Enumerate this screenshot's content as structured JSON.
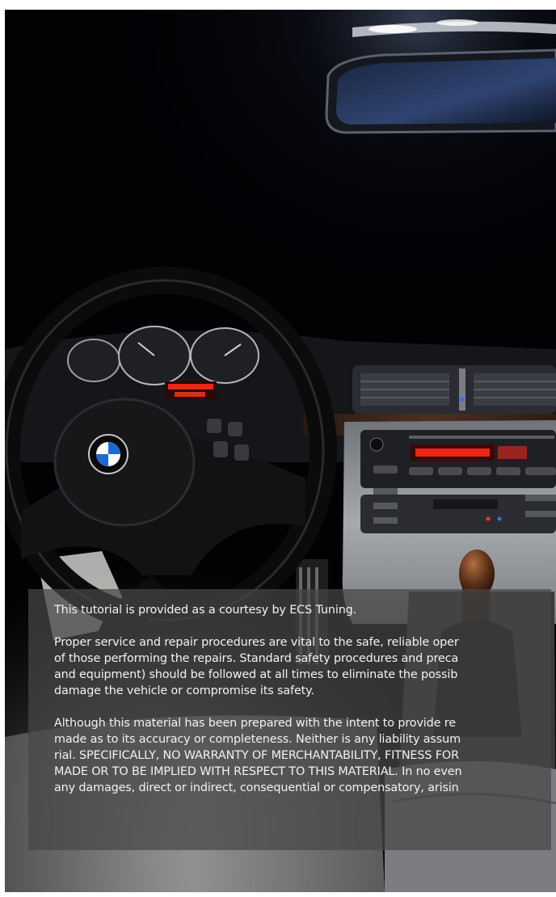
{
  "document": {
    "photo_subject": "BMW dashboard interior at night",
    "disclaimer": {
      "intro": "This tutorial is provided as a courtesy by ECS Tuning.",
      "paragraph1_lines": [
        "Proper service and repair procedures are vital to the safe, reliable oper",
        "of those performing the repairs. Standard safety procedures and preca",
        "and equipment) should be followed at all times to eliminate the possib",
        "damage the vehicle or compromise its safety."
      ],
      "paragraph2_lines": [
        "Although this material has been prepared with the intent to provide re",
        "made as to its accuracy or completeness. Neither is any liability assum",
        "rial. SPECIFICALLY, NO WARRANTY OF MERCHANTABILITY, FITNESS FOR",
        "MADE OR TO BE IMPLIED WITH RESPECT TO THIS MATERIAL. In no even",
        "any damages, direct or indirect, consequential or compensatory, arisin"
      ]
    }
  },
  "colors": {
    "overlay": "#464646",
    "text": "#f2f2f2",
    "display_red": "#ff2a1a"
  }
}
